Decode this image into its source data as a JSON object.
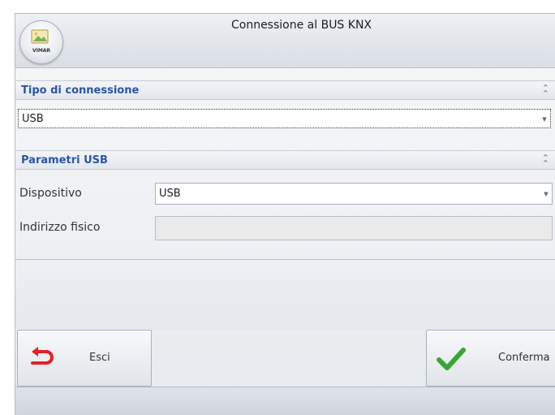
{
  "window": {
    "title": "Connessione al BUS KNX",
    "brand": "VIMAR"
  },
  "connection_type": {
    "header": "Tipo di connessione",
    "selected": "USB"
  },
  "usb_params": {
    "header": "Parametri USB",
    "device_label": "Dispositivo",
    "device_value": "USB",
    "address_label": "Indirizzo fisico",
    "address_value": ""
  },
  "buttons": {
    "exit_label": "Esci",
    "confirm_label": "Conferma"
  },
  "colors": {
    "section_header_text": "#2a56a8",
    "exit_icon": "#e32222",
    "confirm_icon": "#3aa534"
  },
  "icons": {
    "collapse": "double-chevron-up-icon",
    "dropdown": "chevron-down-icon",
    "exit": "undo-arrow-icon",
    "confirm": "checkmark-icon",
    "logo": "vimar-logo-icon"
  }
}
